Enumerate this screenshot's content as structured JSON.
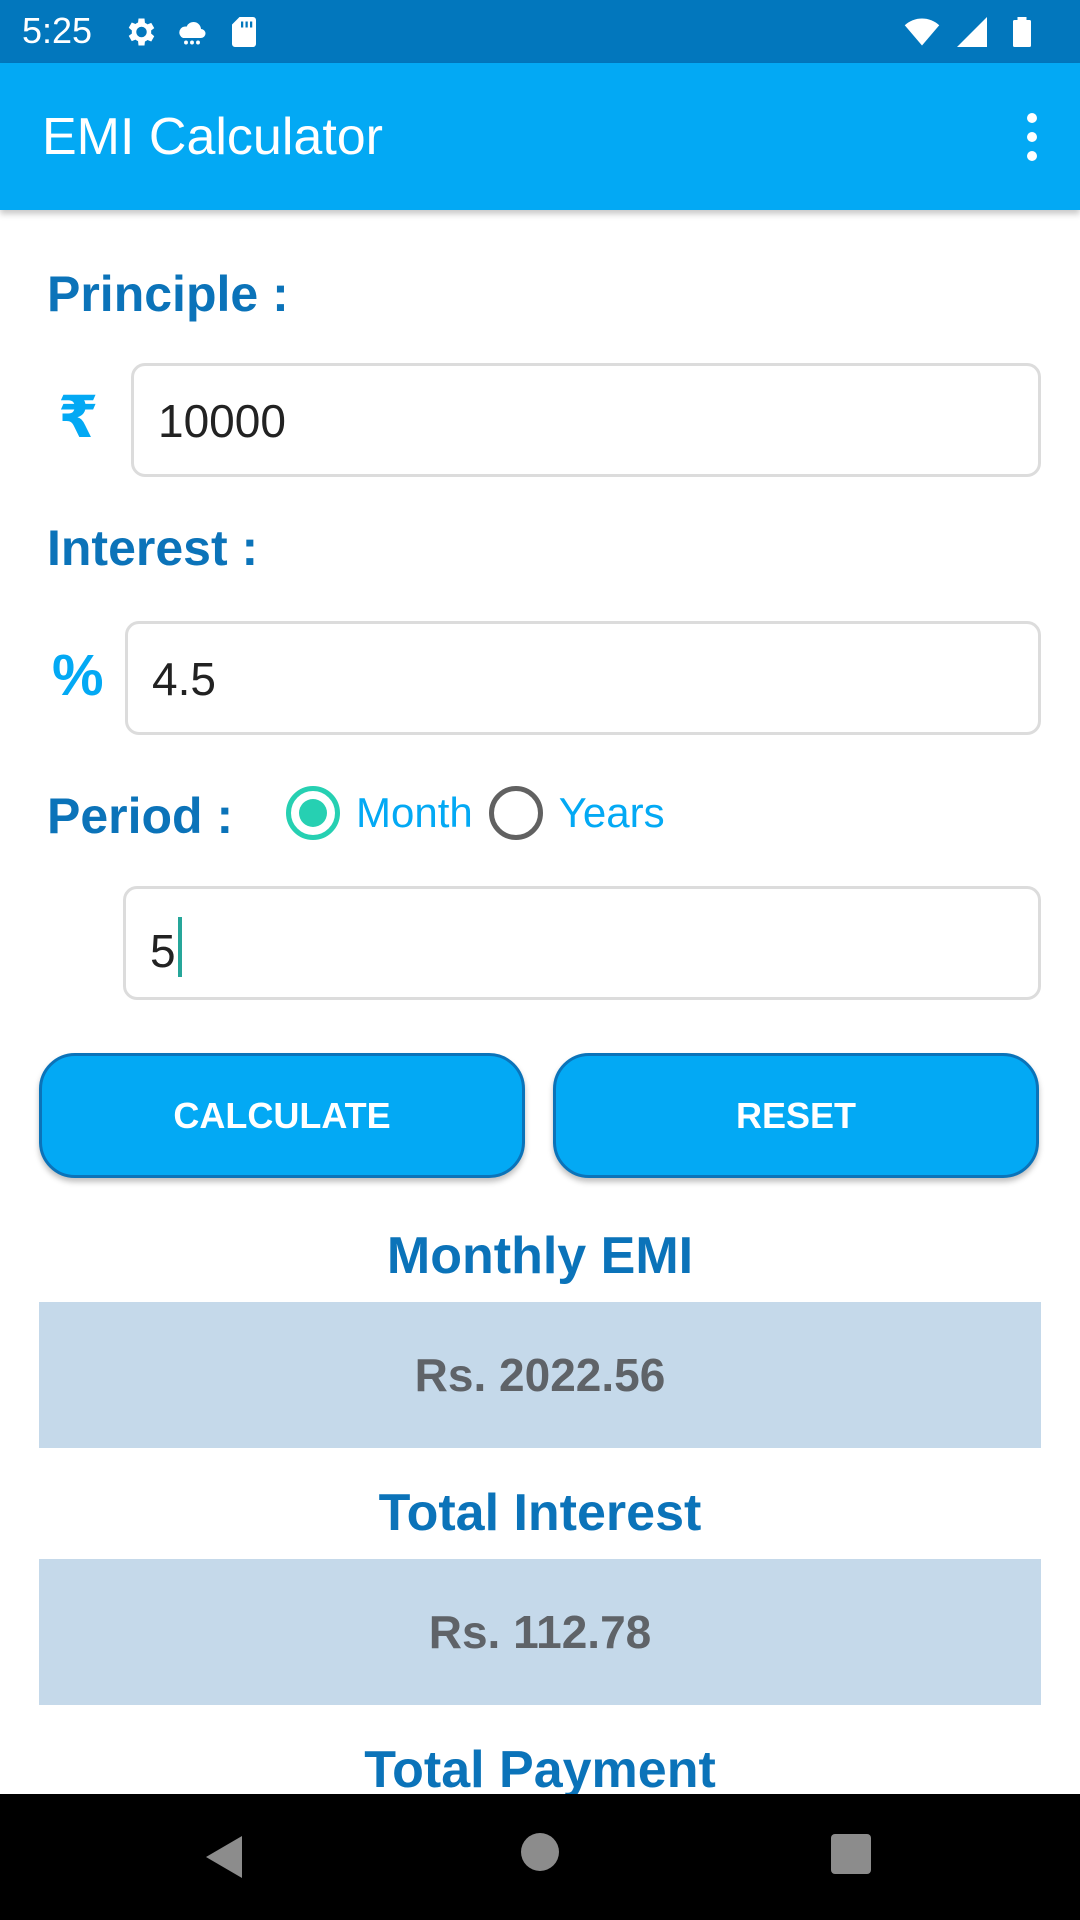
{
  "status_bar": {
    "time": "5:25",
    "left_icons": [
      "gear-icon",
      "weather-icon",
      "sd-card-icon"
    ],
    "right_icons": [
      "wifi-icon",
      "signal-icon",
      "battery-icon"
    ]
  },
  "app_bar": {
    "title": "EMI Calculator",
    "menu_icon": "overflow-menu-icon"
  },
  "form": {
    "principle_label": "Principle :",
    "principle_prefix": "₹",
    "principle_value": "10000",
    "interest_label": "Interest :",
    "interest_prefix": "%",
    "interest_value": "4.5",
    "period_label": "Period :",
    "period_options": [
      "Month",
      "Years"
    ],
    "period_selected": "Month",
    "period_value": "5"
  },
  "buttons": {
    "calculate": "CALCULATE",
    "reset": "RESET"
  },
  "results": {
    "monthly_emi_label": "Monthly EMI",
    "monthly_emi_value": "Rs. 2022.56",
    "total_interest_label": "Total Interest",
    "total_interest_value": "Rs. 112.78",
    "total_payment_label": "Total Payment"
  },
  "colors": {
    "status_bar": "#0277bd",
    "app_bar": "#03a9f4",
    "label_text": "#0b73b9",
    "radio_checked": "#26d0b2",
    "result_box": "#c5d9ea"
  }
}
